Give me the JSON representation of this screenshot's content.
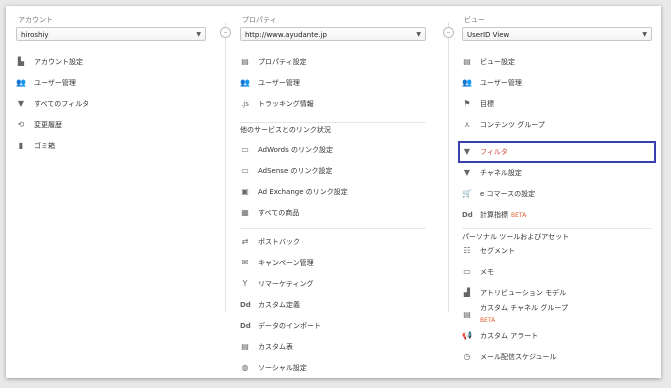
{
  "account": {
    "header": "アカウント",
    "selected": "hiroshiy",
    "items": [
      {
        "icon": "building-icon",
        "label": "アカウント設定"
      },
      {
        "icon": "users-icon",
        "label": "ユーザー管理"
      },
      {
        "icon": "filter-icon",
        "label": "すべてのフィルタ"
      },
      {
        "icon": "history-icon",
        "label": "変更履歴"
      },
      {
        "icon": "trash-icon",
        "label": "ゴミ箱"
      }
    ]
  },
  "property": {
    "header": "プロパティ",
    "selected": "http://www.ayudante.jp",
    "items": [
      {
        "icon": "property-settings-icon",
        "label": "プロパティ設定"
      },
      {
        "icon": "users-icon",
        "label": "ユーザー管理"
      },
      {
        "icon": "js-icon",
        "label": "トラッキング情報"
      }
    ],
    "section_title": "他のサービスとのリンク状況",
    "link_items": [
      {
        "icon": "adwords-icon",
        "label": "AdWords のリンク設定"
      },
      {
        "icon": "adsense-icon",
        "label": "AdSense のリンク設定"
      },
      {
        "icon": "adexchange-icon",
        "label": "Ad Exchange のリンク設定"
      },
      {
        "icon": "products-icon",
        "label": "すべての商品"
      }
    ],
    "more_items": [
      {
        "icon": "postback-icon",
        "label": "ポストバック"
      },
      {
        "icon": "campaign-icon",
        "label": "キャンペーン管理"
      },
      {
        "icon": "remarketing-icon",
        "label": "リマーケティング"
      },
      {
        "icon": "dd-icon",
        "label": "カスタム定義"
      },
      {
        "icon": "dd-icon",
        "label": "データのインポート"
      },
      {
        "icon": "table-icon",
        "label": "カスタム表"
      },
      {
        "icon": "globe-icon",
        "label": "ソーシャル設定"
      }
    ]
  },
  "view": {
    "header": "ビュー",
    "selected": "UserID View",
    "items": [
      {
        "icon": "view-settings-icon",
        "label": "ビュー設定"
      },
      {
        "icon": "users-icon",
        "label": "ユーザー管理"
      },
      {
        "icon": "flag-icon",
        "label": "目標"
      },
      {
        "icon": "content-group-icon",
        "label": "コンテンツ グループ"
      },
      {
        "icon": "filter-icon",
        "label": "フィルタ"
      },
      {
        "icon": "channel-icon",
        "label": "チャネル設定"
      },
      {
        "icon": "cart-icon",
        "label": "e コマースの設定"
      },
      {
        "icon": "dd-icon",
        "label": "計算指標",
        "badge": "BETA"
      }
    ],
    "section_title": "パーソナル ツールおよびアセット",
    "personal_items": [
      {
        "icon": "segment-icon",
        "label": "セグメント"
      },
      {
        "icon": "memo-icon",
        "label": "メモ"
      },
      {
        "icon": "attribution-icon",
        "label": "アトリビューション モデル"
      },
      {
        "icon": "custom-channel-icon",
        "label": "カスタム チャネル グループ",
        "badge": "BETA"
      },
      {
        "icon": "megaphone-icon",
        "label": "カスタム アラート"
      },
      {
        "icon": "clock-icon",
        "label": "メール配信スケジュール"
      }
    ]
  }
}
